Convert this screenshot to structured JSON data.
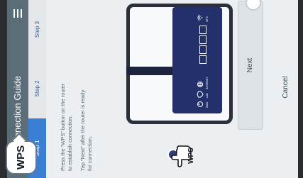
{
  "header": {
    "title": "Connection Guide"
  },
  "steps": [
    {
      "label": "Step 1",
      "active": true
    },
    {
      "label": "Step 2",
      "active": false
    },
    {
      "label": "Step 3",
      "active": false
    }
  ],
  "instructions": [
    "Press the “WPS” button on the router to establish connection.",
    "Tap “Next” after the router is ready for connection."
  ],
  "router": {
    "wps_caption": "WPS",
    "label_wan": "WAN",
    "label_lan": "LAN",
    "label_internet": "INTERNET",
    "label_wps_small": "WPS"
  },
  "buttons": {
    "next": "Next",
    "cancel": "Cancel"
  },
  "badge": {
    "wps": "WPS"
  },
  "colors": {
    "header": "#5b6e78",
    "step_active": "#3a7fd4",
    "router": "#23306b",
    "frame": "#2a2f3a"
  }
}
